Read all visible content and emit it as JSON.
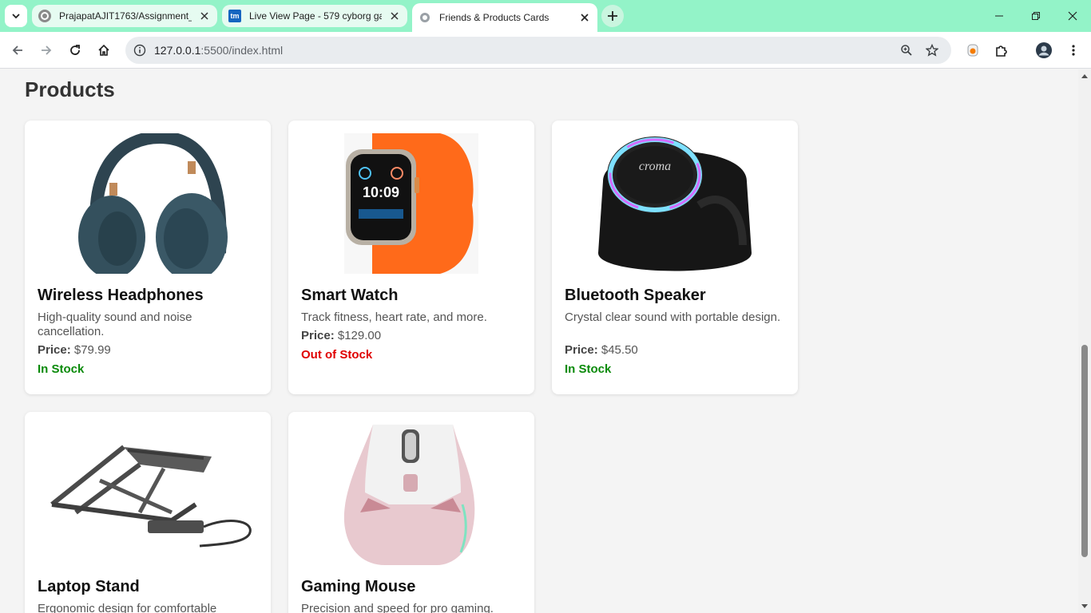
{
  "browser": {
    "tabs": [
      {
        "title": "PrajapatAJIT1763/Assignment_",
        "icon": "github-icon",
        "active": false
      },
      {
        "title": "Live View Page - 579 cyborg ga",
        "icon": "tm-icon",
        "favicon_text": "tm",
        "active": false
      },
      {
        "title": "Friends & Products Cards",
        "icon": "globe-icon",
        "active": true
      }
    ],
    "address": {
      "host": "127.0.0.1",
      "rest": ":5500/index.html"
    },
    "colors": {
      "tabstrip": "#93f3c8",
      "toolbar": "#ffffff"
    }
  },
  "page": {
    "section_title": "Products",
    "products": [
      {
        "name": "Wireless Headphones",
        "description": "High-quality sound and noise cancellation.",
        "price_label": "Price:",
        "price": "$79.99",
        "stock": "In Stock",
        "in_stock": true,
        "image": "headphones-image"
      },
      {
        "name": "Smart Watch",
        "description": "Track fitness, heart rate, and more.",
        "price_label": "Price:",
        "price": "$129.00",
        "stock": "Out of Stock",
        "in_stock": false,
        "image": "smartwatch-image",
        "watch_time": "10:09"
      },
      {
        "name": "Bluetooth Speaker",
        "description": "Crystal clear sound with portable design.",
        "price_label": "Price:",
        "price": "$45.50",
        "stock": "In Stock",
        "in_stock": true,
        "image": "speaker-image",
        "brand_text": "croma"
      },
      {
        "name": "Laptop Stand",
        "description": "Ergonomic design for comfortable",
        "image": "laptop-stand-image"
      },
      {
        "name": "Gaming Mouse",
        "description": "Precision and speed for pro gaming.",
        "image": "gaming-mouse-image"
      }
    ],
    "colors": {
      "in_stock": "#0a8a0a",
      "out_of_stock": "#e00000",
      "background": "#f4f4f4"
    }
  }
}
